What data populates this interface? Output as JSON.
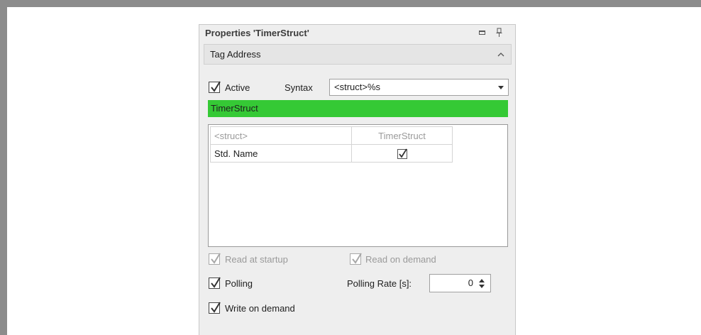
{
  "panel": {
    "title": "Properties 'TimerStruct'",
    "title_buttons": [
      {
        "icon": "maximize-icon"
      },
      {
        "icon": "pin-icon"
      }
    ]
  },
  "section": {
    "label": "Tag Address",
    "collapse_icon": "chevron-up-icon"
  },
  "active": {
    "label": "Active",
    "checked": true
  },
  "syntax": {
    "label": "Syntax",
    "value": "<struct>%s"
  },
  "resolved_address": {
    "text": "TimerStruct",
    "color": "#35c935"
  },
  "grid": {
    "headers": [
      "<struct>",
      "TimerStruct"
    ],
    "rows": [
      {
        "name": "Std. Name",
        "checked": true
      }
    ]
  },
  "options": {
    "read_at_startup": {
      "label": "Read at startup",
      "checked": true,
      "enabled": false
    },
    "read_on_demand": {
      "label": "Read on demand",
      "checked": true,
      "enabled": false
    },
    "polling": {
      "label": "Polling",
      "checked": true,
      "enabled": true
    },
    "write_on_demand": {
      "label": "Write on demand",
      "checked": true,
      "enabled": true
    }
  },
  "polling_rate": {
    "label": "Polling Rate [s]:",
    "value": "0"
  }
}
